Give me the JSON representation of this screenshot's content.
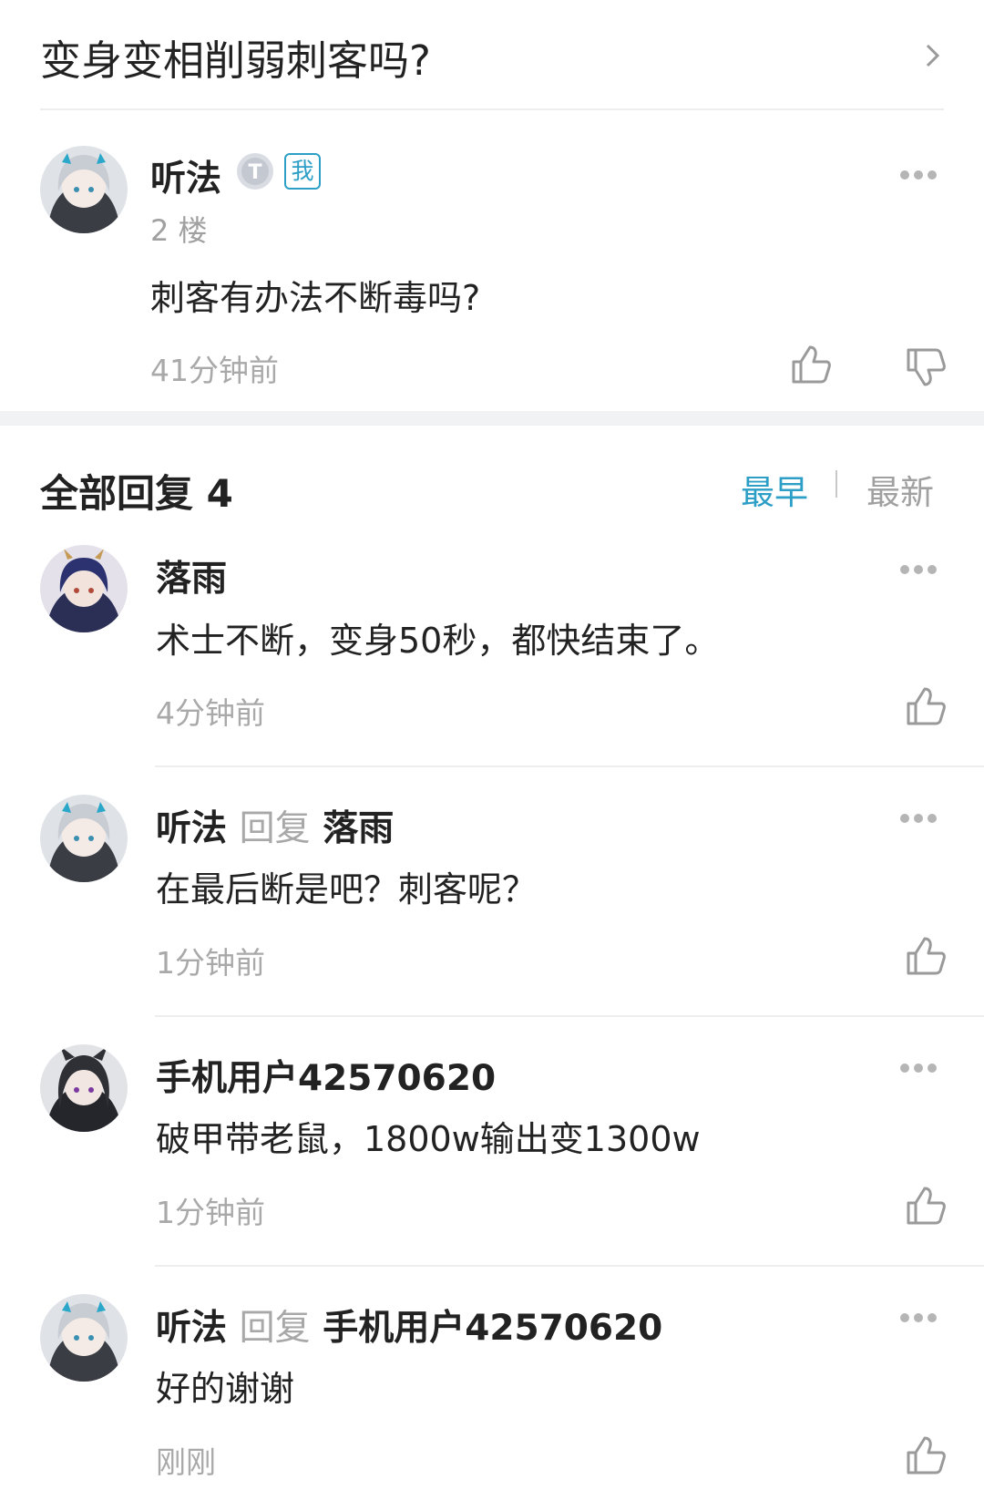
{
  "thread": {
    "title": "变身变相削弱刺客吗?"
  },
  "post": {
    "author": "听法",
    "level_badge": "T",
    "me_badge": "我",
    "floor": "2 楼",
    "content": "刺客有办法不断毒吗?",
    "time": "41分钟前"
  },
  "replies": {
    "header": "全部回复 4",
    "sort_earliest": "最早",
    "sort_latest": "最新",
    "items": [
      {
        "author": "落雨",
        "reply_word": "",
        "reply_to": "",
        "content": "术士不断，变身50秒，都快结束了。",
        "time": "4分钟前"
      },
      {
        "author": "听法",
        "reply_word": "回复",
        "reply_to": "落雨",
        "content": "在最后断是吧？刺客呢？",
        "time": "1分钟前"
      },
      {
        "author": "手机用户42570620",
        "reply_word": "",
        "reply_to": "",
        "content": "破甲带老鼠，1800w输出变1300w",
        "time": "1分钟前"
      },
      {
        "author": "听法",
        "reply_word": "回复",
        "reply_to": "手机用户42570620",
        "content": "好的谢谢",
        "time": "刚刚"
      }
    ]
  },
  "colors": {
    "accent": "#2d9fc7",
    "muted": "#a9a9a9",
    "gap": "#f1f2f4"
  },
  "icons": [
    "chevron-right-icon",
    "more-icon",
    "thumb-up-icon",
    "thumb-down-icon"
  ]
}
